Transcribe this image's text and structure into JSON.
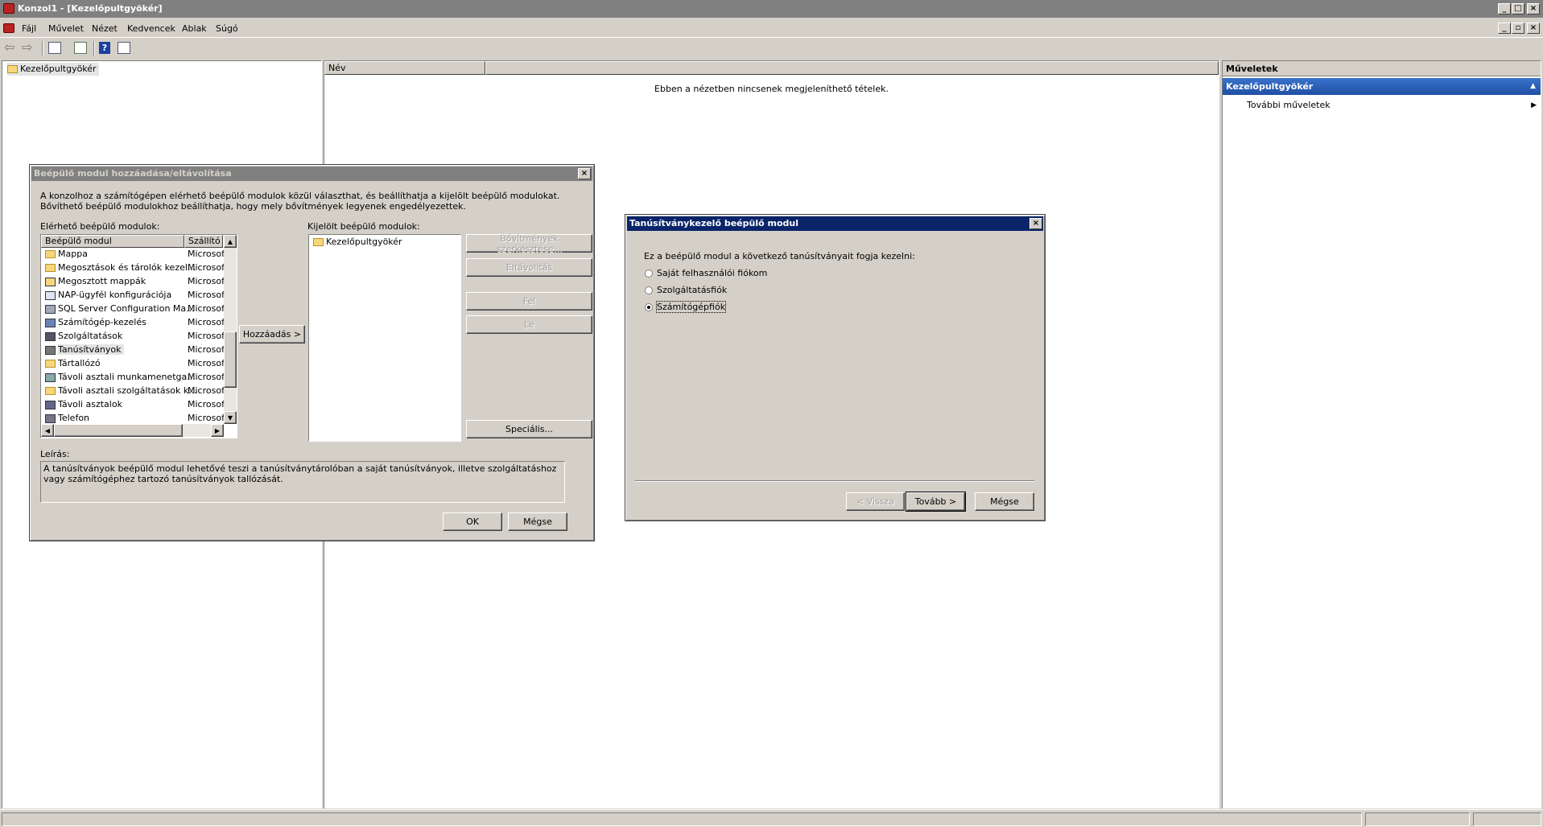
{
  "window": {
    "title": "Konzol1 - [Kezelőpultgyökér]",
    "min": "_",
    "max": "□",
    "close": "×"
  },
  "menu": {
    "items": [
      "Fájl",
      "Művelet",
      "Nézet",
      "Kedvencek",
      "Ablak",
      "Súgó"
    ]
  },
  "tree": {
    "root": "Kezelőpultgyökér"
  },
  "center": {
    "column_name": "Név",
    "empty_message": "Ebben a nézetben nincsenek megjeleníthető tételek."
  },
  "actions": {
    "header": "Műveletek",
    "section": "Kezelőpultgyökér",
    "item": "További műveletek"
  },
  "snapin_dialog": {
    "title": "Beépülő modul hozzáadása/eltávolítása",
    "intro": "A konzolhoz a számítógépen elérhető beépülő modulok közül választhat, és beállíthatja a kijelölt beépülő modulokat. Bővíthető beépülő modulokhoz beállíthatja, hogy mely bővítmények legyenek engedélyezettek.",
    "available_label": "Elérhető beépülő modulok:",
    "col_module": "Beépülő modul",
    "col_vendor": "Szállító",
    "modules": [
      {
        "name": "Mappa",
        "vendor": "Microsoft",
        "icon": "folder-icon"
      },
      {
        "name": "Megosztások és tárolók kezel...",
        "vendor": "Microsoft",
        "icon": "folder-icon"
      },
      {
        "name": "Megosztott mappák",
        "vendor": "Microsoft",
        "icon": "shared-folder-icon"
      },
      {
        "name": "NAP-ügyfél konfigurációja",
        "vendor": "Microsoft",
        "icon": "nap-icon"
      },
      {
        "name": "SQL Server Configuration Ma...",
        "vendor": "Microsoft",
        "icon": "sql-icon"
      },
      {
        "name": "Számítógép-kezelés",
        "vendor": "Microsoft",
        "icon": "computer-icon"
      },
      {
        "name": "Szolgáltatások",
        "vendor": "Microsoft",
        "icon": "services-icon"
      },
      {
        "name": "Tanúsítványok",
        "vendor": "Microsoft",
        "icon": "certificate-icon"
      },
      {
        "name": "Tártallózó",
        "vendor": "Microsoft",
        "icon": "folder-icon"
      },
      {
        "name": "Távoli asztali munkamenetga...",
        "vendor": "Microsoft",
        "icon": "rds-icon"
      },
      {
        "name": "Távoli asztali szolgáltatások k...",
        "vendor": "Microsoft",
        "icon": "folder-icon"
      },
      {
        "name": "Távoli asztalok",
        "vendor": "Microsoft",
        "icon": "remote-desktop-icon"
      },
      {
        "name": "Telefon",
        "vendor": "Microsoft",
        "icon": "phone-icon"
      }
    ],
    "add_button": "Hozzáadás >",
    "selected_label": "Kijelölt beépülő modulok:",
    "selected_items": [
      "Kezelőpultgyökér"
    ],
    "edit_ext_button": "Bővítmények szerkesztése...",
    "remove_button": "Eltávolítás",
    "up_button": "Fel",
    "down_button": "Le",
    "advanced_button": "Speciális...",
    "desc_label": "Leírás:",
    "description": "A tanúsítványok beépülő modul lehetővé teszi a tanúsítványtárolóban a saját tanúsítványok, illetve szolgáltatáshoz vagy számítógéphez tartozó tanúsítványok tallózását.",
    "ok_button": "OK",
    "cancel_button": "Mégse"
  },
  "cert_dialog": {
    "title": "Tanúsítványkezelő beépülő modul",
    "prompt": "Ez a beépülő modul a következő tanúsítványait fogja kezelni:",
    "options": [
      "Saját felhasználói fiókom",
      "Szolgáltatásfiók",
      "Számítógépfiók"
    ],
    "selected_option": "Számítógépfiók",
    "back_button": "< Vissza",
    "next_button": "Tovább >",
    "cancel_button": "Mégse"
  },
  "colors": {
    "active_title": "#0a246a",
    "inactive_title": "#808080",
    "actions_section": "#2b62b8"
  }
}
